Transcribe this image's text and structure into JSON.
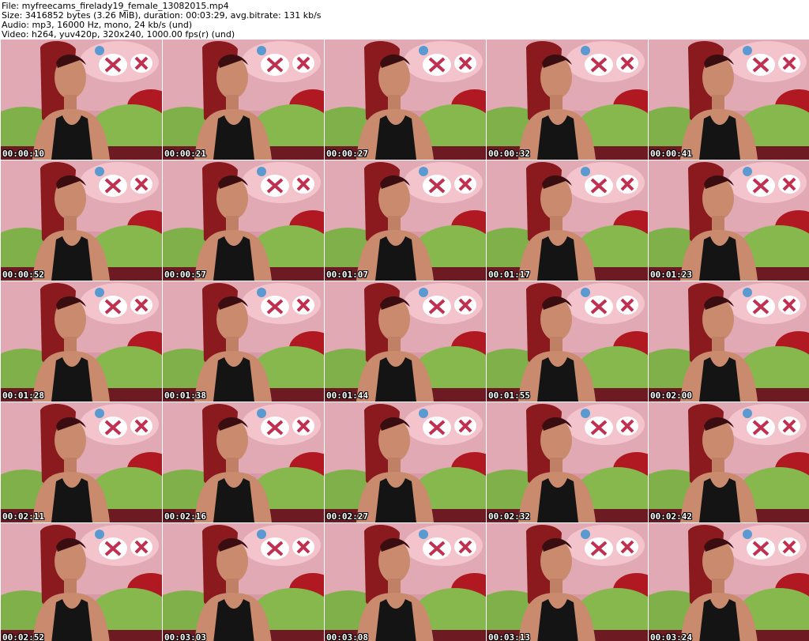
{
  "header": {
    "file": "File: myfreecams_firelady19_female_13082015.mp4",
    "size": "Size: 3416852 bytes (3.26 MiB), duration: 00:03:29, avg.bitrate: 131 kb/s",
    "audio": "Audio: mp3, 16000 Hz, mono, 24 kb/s (und)",
    "video": "Video: h264, yuv420p, 320x240, 1000.00 fps(r) (und)"
  },
  "thumbnails": [
    {
      "time": "00:00:10"
    },
    {
      "time": "00:00:21"
    },
    {
      "time": "00:00:27"
    },
    {
      "time": "00:00:32"
    },
    {
      "time": "00:00:41"
    },
    {
      "time": "00:00:52"
    },
    {
      "time": "00:00:57"
    },
    {
      "time": "00:01:07"
    },
    {
      "time": "00:01:17"
    },
    {
      "time": "00:01:23"
    },
    {
      "time": "00:01:28"
    },
    {
      "time": "00:01:38"
    },
    {
      "time": "00:01:44"
    },
    {
      "time": "00:01:55"
    },
    {
      "time": "00:02:00"
    },
    {
      "time": "00:02:11"
    },
    {
      "time": "00:02:16"
    },
    {
      "time": "00:02:27"
    },
    {
      "time": "00:02:32"
    },
    {
      "time": "00:02:42"
    },
    {
      "time": "00:02:52"
    },
    {
      "time": "00:03:03"
    },
    {
      "time": "00:03:08"
    },
    {
      "time": "00:03:13"
    },
    {
      "time": "00:03:24"
    }
  ],
  "colors": {
    "background": "#ffffff",
    "wall_pink": "#d89aa6",
    "pillow_green": "#7fb04a",
    "hair_red": "#8a1a1e",
    "skin": "#c98a6e",
    "top_black": "#141414",
    "stamp_text": "#ffffff"
  }
}
